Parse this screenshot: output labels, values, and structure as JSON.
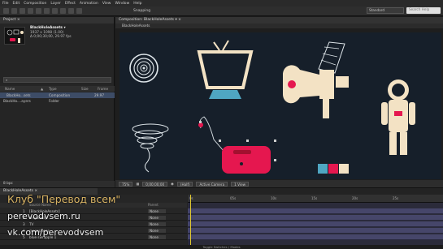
{
  "menu": [
    "File",
    "Edit",
    "Composition",
    "Layer",
    "Effect",
    "Animation",
    "View",
    "Window",
    "Help"
  ],
  "toolbar": {
    "snapping_label": "Snapping",
    "workspace_label": "Workspace:",
    "workspace_value": "Standard",
    "search_placeholder": "Search Help"
  },
  "project": {
    "tab": "Project ×",
    "comp_name": "BlackHoleAssets ▾",
    "comp_size": "1937 x 1098 (1.00)",
    "comp_duration": "Δ 0;00;30;00, 29.97 fps",
    "columns": [
      "Name",
      "▲",
      "Type",
      "Size",
      "Frame"
    ],
    "items": [
      {
        "name": "BlackHo...sets",
        "type": "Composition",
        "frame": "29.97"
      },
      {
        "name": "BlackHo....ayers",
        "type": "Folder",
        "frame": ""
      }
    ],
    "footer": "8 bpc"
  },
  "composition": {
    "tab": "Composition: BlackHoleAssets ▾ ×",
    "subtab": "BlackHoleAssets",
    "zoom": "75%",
    "timecode": "0;00;00;00",
    "resolution": "(Half)",
    "camera": "Active Camera",
    "view": "1 View"
  },
  "timeline": {
    "tab": "BlackHoleAssets ×",
    "header_source": "Source Name",
    "header_parent": "Parent",
    "layers": [
      {
        "num": "1",
        "name": "[BlackHoleAssets]",
        "mode": "None"
      },
      {
        "num": "2",
        "name": "singularity",
        "mode": "None"
      },
      {
        "num": "3",
        "name": "TV",
        "mode": "None"
      },
      {
        "num": "4",
        "name": "megaphone",
        "mode": "None"
      },
      {
        "num": "5",
        "name": "blue swrapple 1",
        "mode": "None"
      }
    ],
    "ticks": [
      "0s",
      "05s",
      "10s",
      "15s",
      "20s",
      "25s"
    ],
    "footer": "Toggle Switches / Modes"
  },
  "watermark": {
    "line1": "Клуб \"Перевод всем\"",
    "line2": "perevodvsem.ru",
    "line3": "vk.com/perevodvsem"
  },
  "colors": {
    "accent_red": "#e5174f",
    "cream": "#f3e2c4",
    "canvas": "#161f2a",
    "tv_screen": "#4fa6c2"
  }
}
